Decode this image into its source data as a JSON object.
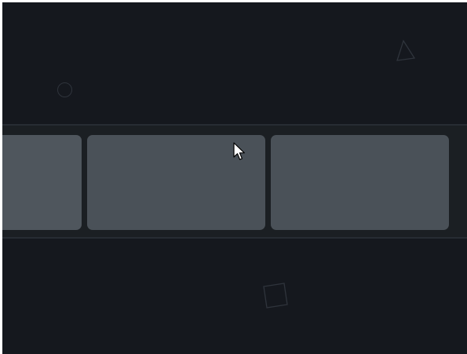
{
  "theme": {
    "background": "#15181e",
    "carousel_background": "#1b1f23",
    "carousel_border": "#272c33",
    "card_color": "#4a5158",
    "deco_stroke": "#2f343c"
  },
  "carousel": {
    "cards": [
      {
        "name": "card-1",
        "partially_visible": true
      },
      {
        "name": "card-2",
        "partially_visible": false
      },
      {
        "name": "card-3",
        "partially_visible": false
      }
    ]
  },
  "decorations": [
    {
      "shape": "circle-outline-icon"
    },
    {
      "shape": "triangle-outline-icon"
    },
    {
      "shape": "square-outline-icon"
    }
  ],
  "cursor": {
    "icon": "mouse-pointer-icon"
  }
}
